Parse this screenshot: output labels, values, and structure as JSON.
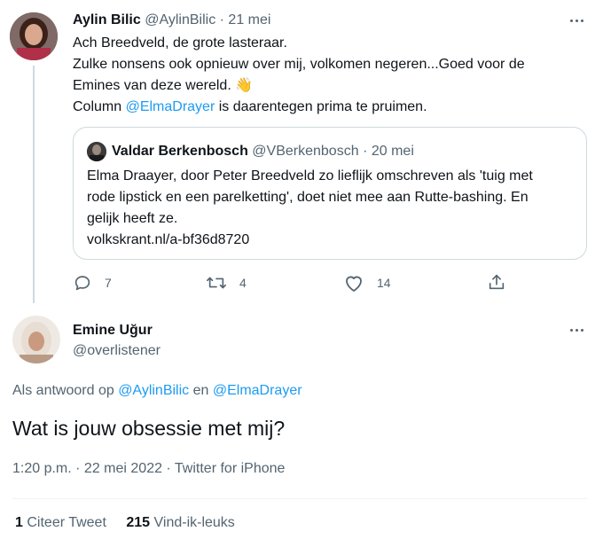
{
  "tweet1": {
    "author_name": "Aylin Bilic",
    "handle": "@AylinBilic",
    "separator": "·",
    "date": "21 mei",
    "line1": "Ach Breedveld, de grote lasteraar.",
    "line2": "Zulke nonsens ook opnieuw over mij, volkomen negeren...Goed voor de",
    "line3": "Emines van deze wereld.",
    "emoji": "👋",
    "line4_pre": "Column ",
    "line4_mention": "@ElmaDrayer",
    "line4_post": " is daarentegen prima te pruimen.",
    "quote": {
      "author_name": "Valdar Berkenbosch",
      "handle": "@VBerkenbosch",
      "separator": "·",
      "date": "20 mei",
      "line1": "Elma Draayer, door Peter Breedveld zo lieflijk omschreven als 'tuig met",
      "line2": "rode lipstick en een parelketting', doet niet mee aan Rutte-bashing. En",
      "line3": "gelijk heeft ze.",
      "link": "volkskrant.nl/a-bf36d8720"
    },
    "actions": {
      "reply_count": "7",
      "retweet_count": "4",
      "like_count": "14"
    }
  },
  "tweet2": {
    "author_name": "Emine Uğur",
    "handle": "@overlistener",
    "reply_prefix": "Als antwoord op ",
    "reply_mention1": "@AylinBilic",
    "reply_and": " en ",
    "reply_mention2": "@ElmaDrayer",
    "text": "Wat is jouw obsessie met mij?",
    "meta": "1:20 p.m. · 22 mei 2022 · Twitter for iPhone"
  },
  "stats": {
    "quote_count": "1",
    "quote_label": "Citeer Tweet",
    "like_count": "215",
    "like_label": "Vind-ik-leuks"
  },
  "colors": {
    "link": "#1d9bf0",
    "muted": "#536471",
    "border": "#cfd9de"
  }
}
